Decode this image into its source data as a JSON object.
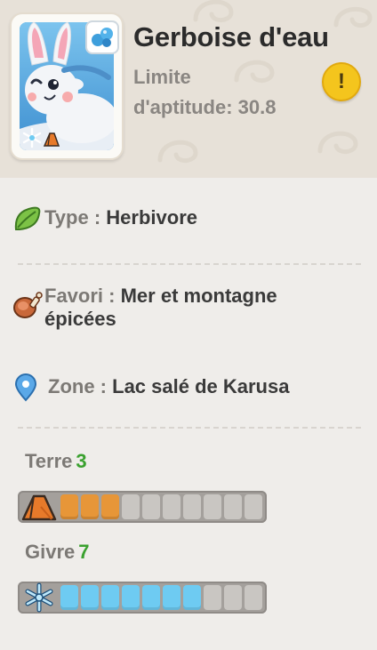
{
  "pal": {
    "name": "Gerboise d'eau",
    "aptitude_line1": "Limite",
    "aptitude_line2": "d'aptitude: 30.8",
    "element_badge_icon": "water-drop-icon",
    "alert_symbol": "!"
  },
  "info": {
    "type_label": "Type :",
    "type_value": "Herbivore",
    "favori_label": "Favori :",
    "favori_value_line1": "Mer et montagne",
    "favori_value_line2": "épicées",
    "zone_label": "Zone :",
    "zone_value": "Lac salé de Karusa"
  },
  "work": [
    {
      "name": "Terre",
      "level": "3",
      "level_value": 3,
      "max": 10,
      "color": "#e79638",
      "icon": "earth-pyramid-icon"
    },
    {
      "name": "Givre",
      "level": "7",
      "level_value": 7,
      "max": 10,
      "color": "#6ecbf2",
      "icon": "snowflake-icon"
    }
  ],
  "colors": {
    "accent_green": "#3aa12f",
    "alert_yellow": "#f4c51d"
  }
}
